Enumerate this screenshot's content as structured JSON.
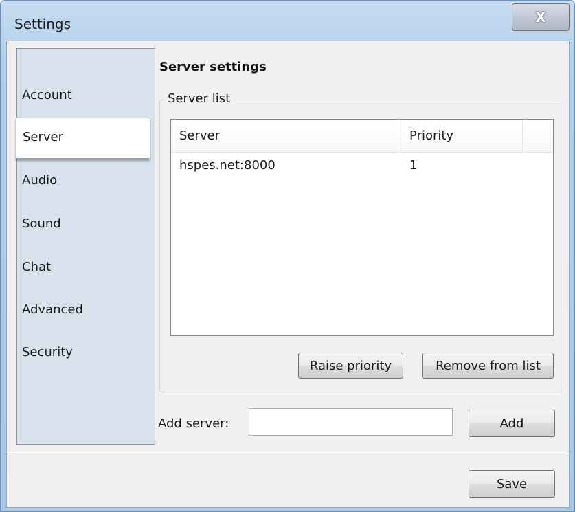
{
  "window": {
    "title": "Settings",
    "close_label": "X"
  },
  "sidebar": {
    "items": [
      {
        "label": "Account",
        "active": false
      },
      {
        "label": "Server",
        "active": true
      },
      {
        "label": "Audio",
        "active": false
      },
      {
        "label": "Sound",
        "active": false
      },
      {
        "label": "Chat",
        "active": false
      },
      {
        "label": "Advanced",
        "active": false
      },
      {
        "label": "Security",
        "active": false
      }
    ]
  },
  "panel": {
    "title": "Server settings",
    "server_list": {
      "legend": "Server list",
      "columns": [
        "Server",
        "Priority"
      ],
      "rows": [
        {
          "server": "hspes.net:8000",
          "priority": "1"
        }
      ],
      "raise_priority_label": "Raise priority",
      "remove_label": "Remove from list"
    },
    "add_server": {
      "label": "Add server:",
      "value": "",
      "button_label": "Add"
    }
  },
  "footer": {
    "save_label": "Save"
  }
}
